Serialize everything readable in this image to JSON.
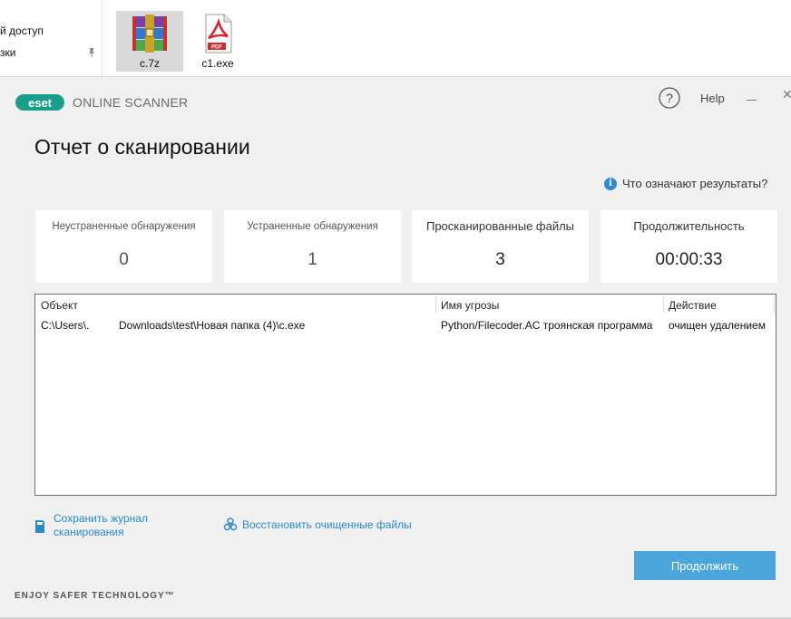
{
  "explorer": {
    "nav_items": [
      "й доступ",
      "зки"
    ],
    "files": [
      {
        "name": "c.7z",
        "icon": "winrar-archive-icon",
        "selected": true
      },
      {
        "name": "c1.exe",
        "icon": "pdf-file-icon",
        "selected": false
      }
    ]
  },
  "scanner": {
    "brand_logo": "eset",
    "brand_name": "ONLINE SCANNER",
    "help_label": "Help",
    "title": "Отчет о сканировании",
    "info_link": "Что означают результаты?",
    "stats": [
      {
        "label": "Неустраненные обнаружения",
        "value": "0"
      },
      {
        "label": "Устраненные обнаружения",
        "value": "1"
      },
      {
        "label": "Просканированные файлы",
        "value": "3"
      },
      {
        "label": "Продолжительность",
        "value": "00:00:33"
      }
    ],
    "table": {
      "headers": [
        "Объект",
        "Имя угрозы",
        "Действие"
      ],
      "rows": [
        {
          "object_prefix": "C:\\Users\\.",
          "object_path": "Downloads\\test\\Новая папка (4)\\c.exe",
          "threat": "Python/Filecoder.AC троянская программа",
          "action": "очищен удалением"
        }
      ]
    },
    "save_log_line1": "Сохранить журнал",
    "save_log_line2": "сканирования",
    "restore_link": "Восстановить очищенные файлы",
    "continue_label": "Продолжить",
    "footer": "ENJOY SAFER TECHNOLOGY™"
  },
  "colors": {
    "accent": "#2a8ac8",
    "button": "#4aa6dc",
    "brand": "#1a9e8c"
  }
}
